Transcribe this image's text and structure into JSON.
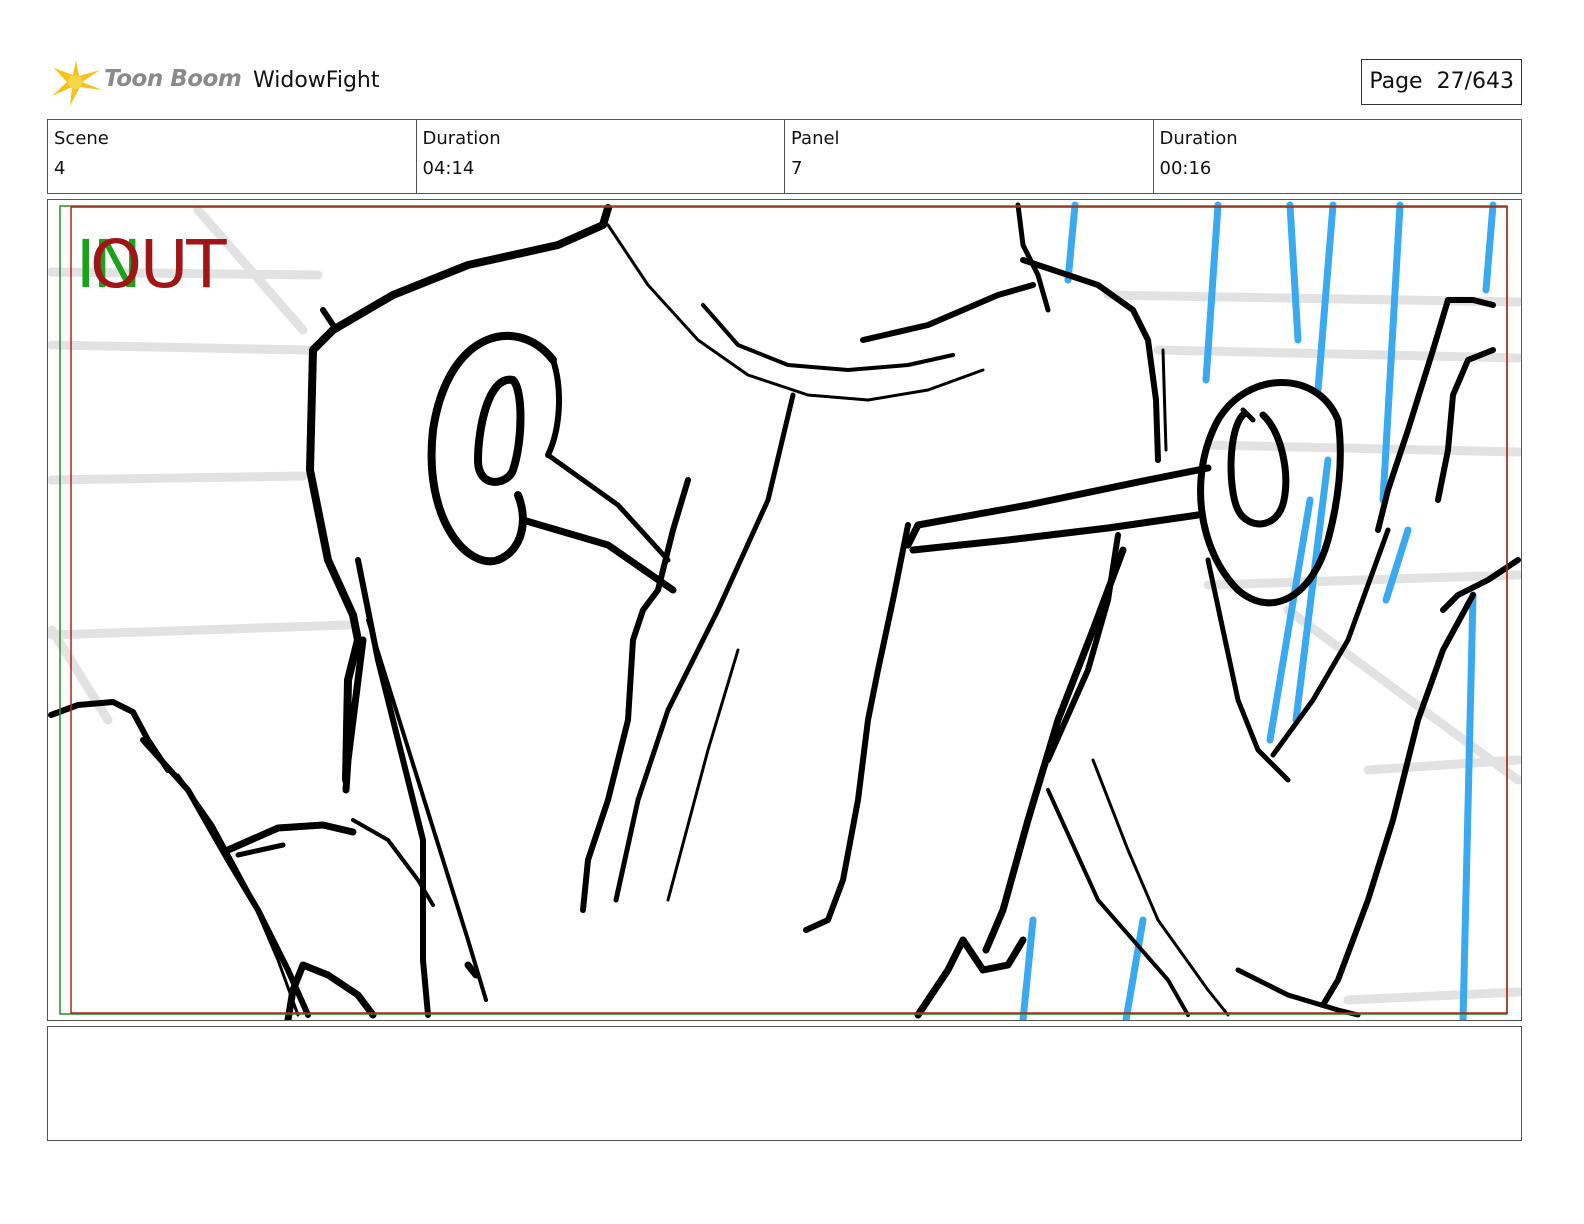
{
  "header": {
    "logo_text": "Toon Boom",
    "project_title": "WidowFight",
    "page_label": "Page",
    "page_value": "27/643"
  },
  "info": [
    {
      "label": "Scene",
      "value": "4"
    },
    {
      "label": "Duration",
      "value": "04:14"
    },
    {
      "label": "Panel",
      "value": "7"
    },
    {
      "label": "Duration",
      "value": "00:16"
    }
  ],
  "panel": {
    "in_marker": "IN",
    "out_marker": "OUT",
    "colors": {
      "in": "#1aa31a",
      "out": "#a01515",
      "speed_lines": "#3aa9f0",
      "background_lines": "#e2e2e2",
      "ink": "#000000"
    }
  },
  "notes": {
    "text": ""
  }
}
